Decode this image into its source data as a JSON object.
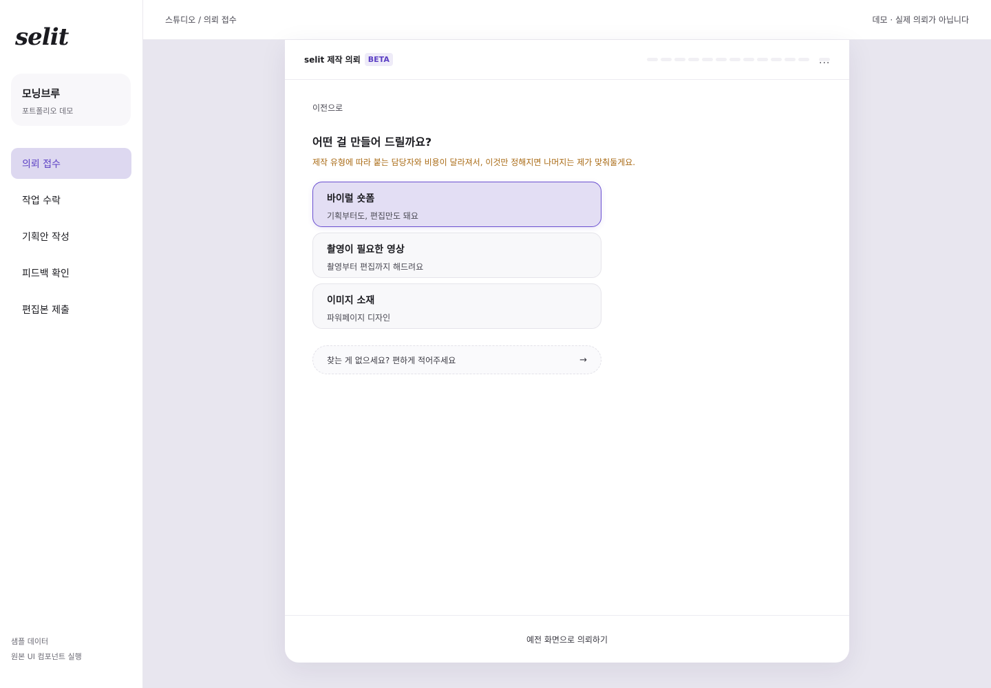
{
  "sidebar": {
    "logo": "selit",
    "workspace": {
      "name": "모닝브루",
      "subtitle": "포트폴리오 데모"
    },
    "items": [
      {
        "label": "의뢰 접수",
        "active": true
      },
      {
        "label": "작업 수락",
        "active": false
      },
      {
        "label": "기획안 작성",
        "active": false
      },
      {
        "label": "피드백 확인",
        "active": false
      },
      {
        "label": "편집본 제출",
        "active": false
      }
    ],
    "footer": {
      "sample": "샘플 데이터",
      "run": "원본 UI 컴포넌트 실행"
    }
  },
  "topbar": {
    "breadcrumb": "스튜디오 / 의뢰 접수",
    "note": "데모 · 실제 의뢰가 아닙니다"
  },
  "card": {
    "title": "selit 제작 의뢰",
    "badge": "BETA",
    "back": "이전으로",
    "question": "어떤 걸 만들어 드릴까요?",
    "hint": "제작 유형에 따라 붙는 담당자와 비용이 달라져서, 이것만 정해지면 나머지는 제가 맞춰둘게요.",
    "options": [
      {
        "title": "바이럴 숏폼",
        "desc": "기획부터도, 편집만도 돼요",
        "selected": true
      },
      {
        "title": "촬영이 필요한 영상",
        "desc": "촬영부터 편집까지 해드려요",
        "selected": false
      },
      {
        "title": "이미지 소재",
        "desc": "파워페이지 디자인",
        "selected": false
      }
    ],
    "fallback": "찾는 게 없으세요? 편하게 적어주세요",
    "footer_link": "예전 화면으로 의뢰하기"
  },
  "colors": {
    "accent": "#5b3fc4",
    "accent_bg": "#ddd8f0",
    "hint": "#a96a14",
    "page_bg": "#e8e6ef"
  }
}
